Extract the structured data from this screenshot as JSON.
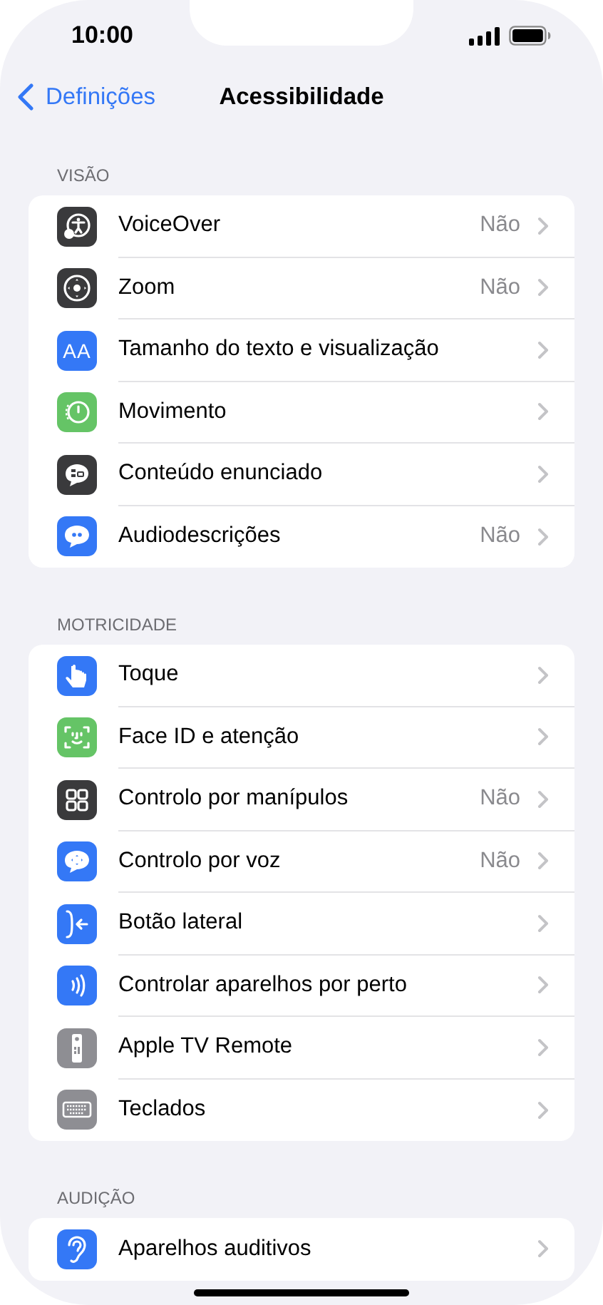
{
  "status_bar": {
    "time": "10:00"
  },
  "nav": {
    "back": "Definições",
    "title": "Acessibilidade"
  },
  "sections": [
    {
      "header": "VISÃO",
      "rows": [
        {
          "label": "VoiceOver",
          "value": "Não"
        },
        {
          "label": "Zoom",
          "value": "Não"
        },
        {
          "label": "Tamanho do texto e visualização",
          "icon_text": "AA"
        },
        {
          "label": "Movimento"
        },
        {
          "label": "Conteúdo enunciado"
        },
        {
          "label": "Audiodescrições",
          "value": "Não"
        }
      ]
    },
    {
      "header": "MOTRICIDADE",
      "rows": [
        {
          "label": "Toque"
        },
        {
          "label": "Face ID e atenção"
        },
        {
          "label": "Controlo por manípulos",
          "value": "Não"
        },
        {
          "label": "Controlo por voz",
          "value": "Não"
        },
        {
          "label": "Botão lateral"
        },
        {
          "label": "Controlar aparelhos por perto"
        },
        {
          "label": "Apple TV Remote"
        },
        {
          "label": "Teclados"
        }
      ]
    },
    {
      "header": "AUDIÇÃO",
      "rows": [
        {
          "label": "Aparelhos auditivos"
        }
      ]
    }
  ]
}
